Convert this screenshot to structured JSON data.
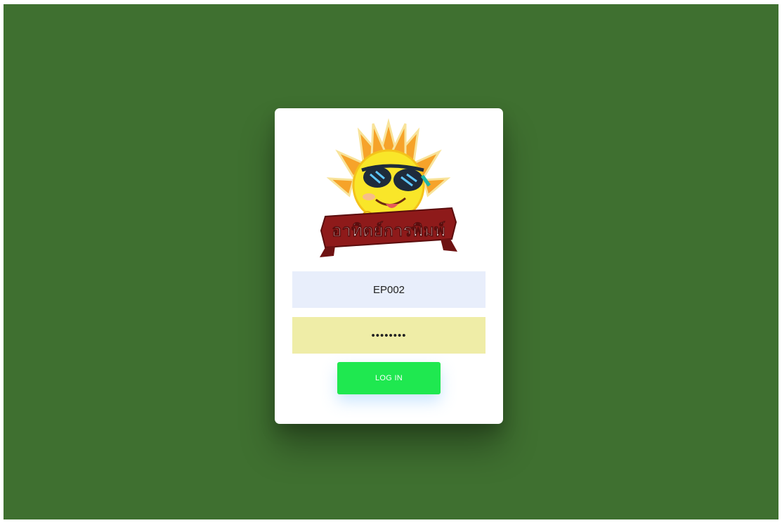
{
  "brand": {
    "logo_text": "อาทิตย์การพิมพ์",
    "logo_icon": "smiling-sun-with-sunglasses"
  },
  "login_form": {
    "username_value": "EP002",
    "password_value": "12345678",
    "login_label": "LOG IN"
  },
  "colors": {
    "background": "#3f7030",
    "card": "#ffffff",
    "username_field": "#e8eefb",
    "password_field": "#efeda7",
    "login_button": "#1fe850",
    "banner": "#8e1a1a"
  }
}
